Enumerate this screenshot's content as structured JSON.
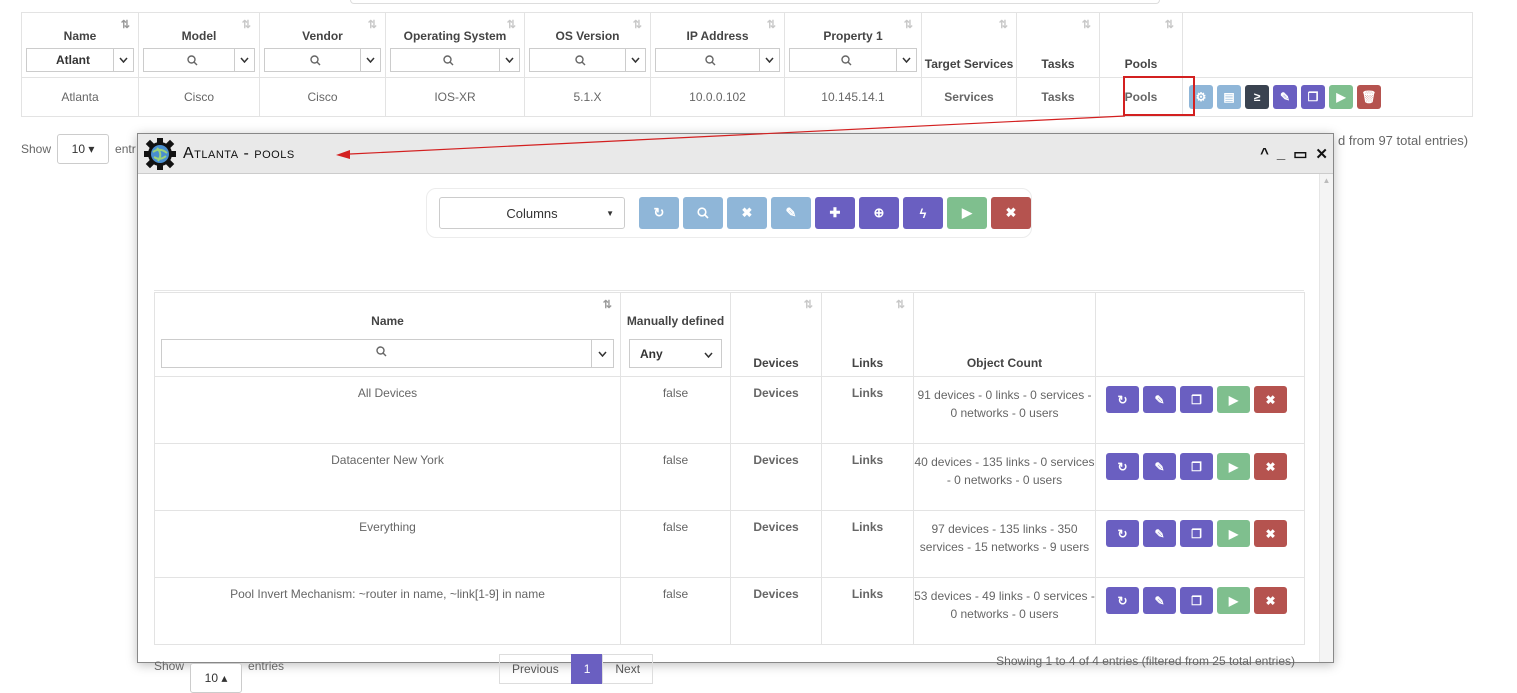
{
  "devices_table": {
    "columns": [
      {
        "label": "Name",
        "filter": "Atlant"
      },
      {
        "label": "Model",
        "filter": ""
      },
      {
        "label": "Vendor",
        "filter": ""
      },
      {
        "label": "Operating System",
        "filter": ""
      },
      {
        "label": "OS Version",
        "filter": ""
      },
      {
        "label": "IP Address",
        "filter": ""
      },
      {
        "label": "Property 1",
        "filter": ""
      },
      {
        "label": "Target Services"
      },
      {
        "label": "Tasks"
      },
      {
        "label": "Pools"
      }
    ],
    "row": {
      "name": "Atlanta",
      "model": "Cisco",
      "vendor": "Cisco",
      "os": "IOS-XR",
      "os_version": "5.1.X",
      "ip": "10.0.0.102",
      "property1": "10.145.14.1",
      "services": "Services",
      "tasks": "Tasks",
      "pools": "Pools"
    },
    "show_label": "Show",
    "page_size": "10",
    "entries_partial": "entr",
    "info_partial": "d from 97 total entries)"
  },
  "panel": {
    "title": "Atlanta - pools",
    "columns_select": "Columns",
    "headers": {
      "name": "Name",
      "manual": "Manually defined",
      "manual_filter": "Any",
      "devices": "Devices",
      "links": "Links",
      "object_count": "Object Count"
    },
    "rows": [
      {
        "name": "All Devices",
        "manual": "false",
        "devices": "Devices",
        "links": "Links",
        "count": "91 devices - 0 links - 0 services - 0 networks - 0 users"
      },
      {
        "name": "Datacenter New York",
        "manual": "false",
        "devices": "Devices",
        "links": "Links",
        "count": "40 devices - 135 links - 0 services - 0 networks - 0 users"
      },
      {
        "name": "Everything",
        "manual": "false",
        "devices": "Devices",
        "links": "Links",
        "count": "97 devices - 135 links - 350 services - 15 networks - 9 users"
      },
      {
        "name": "Pool Invert Mechanism: ~router in name, ~link[1-9] in name",
        "manual": "false",
        "devices": "Devices",
        "links": "Links",
        "count": "53 devices - 49 links - 0 services - 0 networks - 0 users"
      }
    ],
    "show_label": "Show",
    "page_size": "10",
    "entries_label": "entries",
    "previous": "Previous",
    "page": "1",
    "next": "Next",
    "info": "Showing 1 to 4 of 4 entries (filtered from 25 total entries)"
  },
  "colors": {
    "purple": "#6a5fc1",
    "green": "#7fbf8e",
    "red": "#b5534f",
    "light_blue": "#8fb6d8",
    "dark": "#3a4350",
    "highlight": "#d32020"
  }
}
